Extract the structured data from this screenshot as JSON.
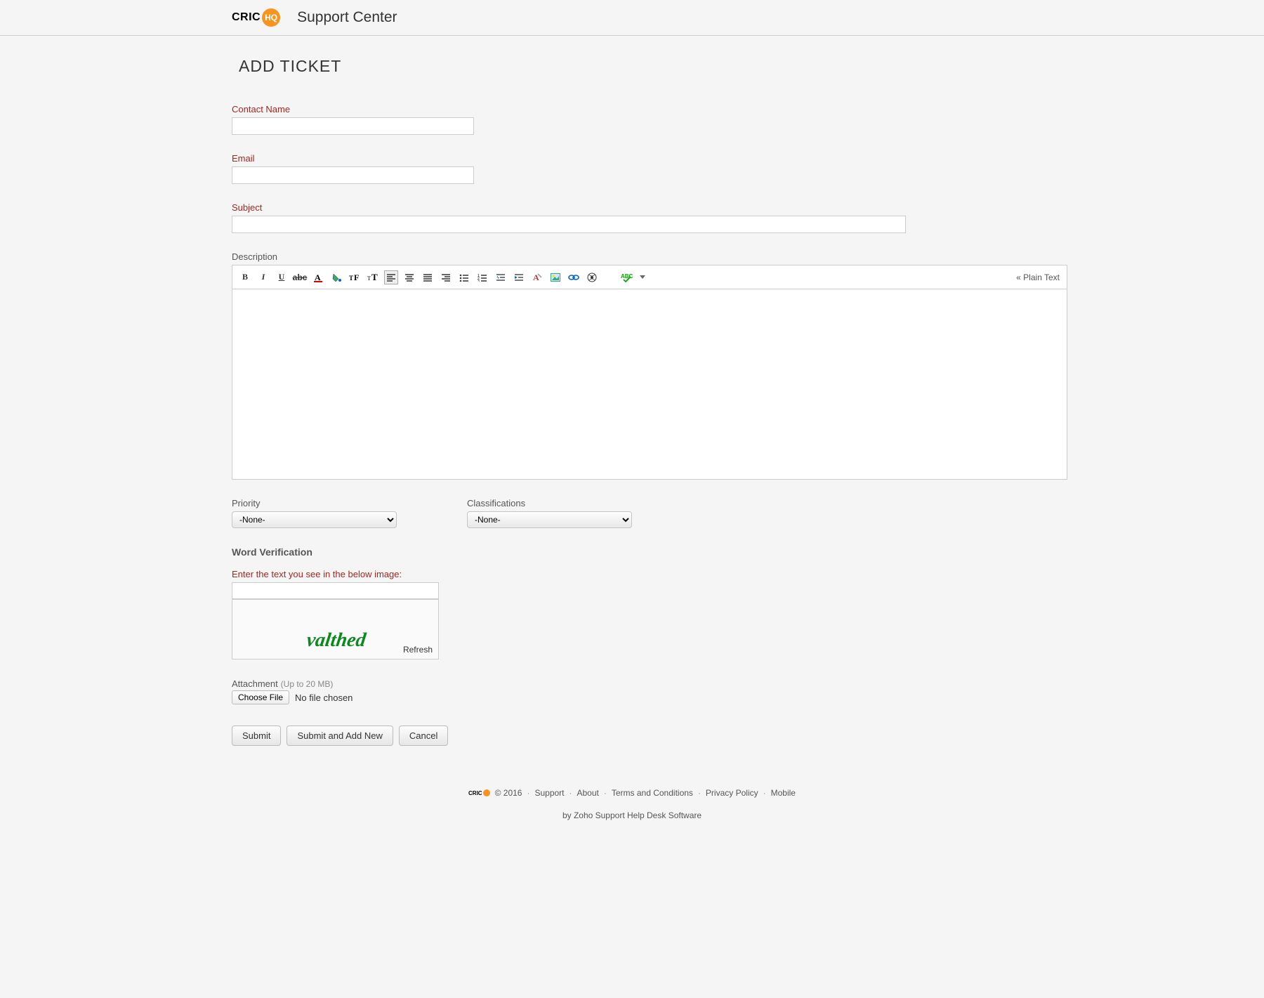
{
  "header": {
    "logo_black": "CRIC",
    "logo_badge": "HQ",
    "title": "Support Center"
  },
  "page": {
    "title": "ADD TICKET"
  },
  "form": {
    "contact_name_label": "Contact Name",
    "email_label": "Email",
    "subject_label": "Subject",
    "description_label": "Description",
    "plaintext_toggle": "« Plain Text",
    "priority": {
      "label": "Priority",
      "value": "-None-"
    },
    "classifications": {
      "label": "Classifications",
      "value": "-None-"
    },
    "word_verification": {
      "title": "Word Verification",
      "instruction": "Enter the text you see in the below image:",
      "captcha_text": "valthed",
      "refresh": "Refresh"
    },
    "attachment": {
      "label": "Attachment",
      "hint": "(Up to 20 MB)",
      "choose": "Choose File",
      "status": "No file chosen"
    },
    "buttons": {
      "submit": "Submit",
      "submit_new": "Submit and Add New",
      "cancel": "Cancel"
    }
  },
  "footer": {
    "copyright": "© 2016",
    "links": [
      "Support",
      "About",
      "Terms and Conditions",
      "Privacy Policy",
      "Mobile"
    ],
    "byline_prefix": "by Zoho Support ",
    "byline_link": "Help Desk Software"
  },
  "toolbar_icons": [
    "bold-icon",
    "italic-icon",
    "underline-icon",
    "strike-icon",
    "font-color-icon",
    "fill-color-icon",
    "font-format-icon",
    "font-size-icon",
    "align-left-icon",
    "align-center-icon",
    "align-justify-icon",
    "align-right-icon",
    "bullet-list-icon",
    "number-list-icon",
    "indent-decrease-icon",
    "indent-increase-icon",
    "clear-format-icon",
    "image-icon",
    "link-icon",
    "embed-icon",
    "spellcheck-icon",
    "spellcheck-dropdown-icon"
  ]
}
